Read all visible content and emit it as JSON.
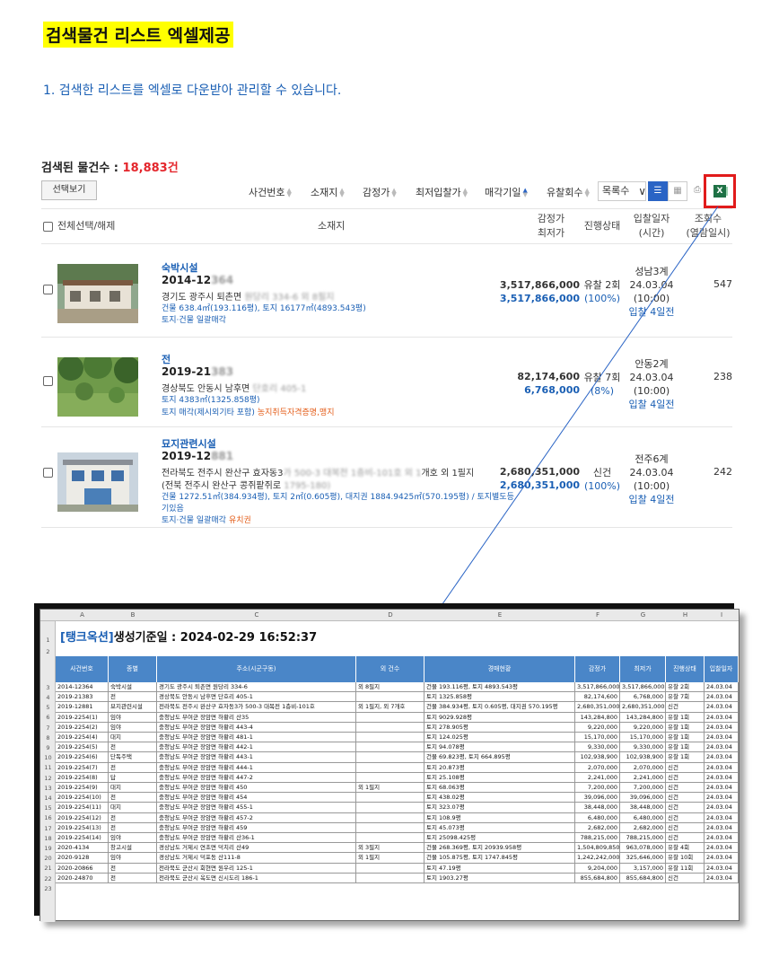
{
  "page": {
    "title": "검색물건 리스트 엑셀제공",
    "step": "1.  검색한 리스트를 엑셀로 다운받아 관리할 수 있습니다."
  },
  "results": {
    "label": "검색된 물건수 : ",
    "count": "18,883건"
  },
  "toolbar": {
    "select_view": "선택보기",
    "sorts": [
      "사건번호",
      "소재지",
      "감정가",
      "최저입찰가",
      "매각기일",
      "유찰회수"
    ],
    "dropdown_value": "목록수",
    "colors": {
      "accent": "#2a64c5",
      "excel": "#1e7145",
      "highlight": "#e11b1b"
    }
  },
  "list_header": {
    "select_all": "전체선택/해제",
    "location": "소재지",
    "appraisal": "감정가",
    "minimum": "최저가",
    "progress": "진행상태",
    "bid_date": "입찰일자",
    "bid_time": "(시간)",
    "views": "조회수",
    "views_sub": "(열람일시)"
  },
  "items": [
    {
      "category": "숙박시설",
      "case_prefix": "2014-12",
      "case_blur": "364",
      "addr_prefix": "경기도 광주시 퇴촌면 ",
      "addr_blur": "원당리 334-6 외 8필지",
      "area": "건물 638.4㎡(193.116평), 토지 16177㎡(4893.543평)",
      "tag": "토지·건물 일괄매각",
      "warn": "",
      "appraisal": "3,517,866,000",
      "minimum": "3,517,866,000",
      "status": "유찰 2회",
      "pct": "(100%)",
      "court": "성남3계",
      "date": "24.03.04",
      "time": "(10:00)",
      "countdown": "입찰 4일전",
      "views": "547"
    },
    {
      "category": "전",
      "case_prefix": "2019-21",
      "case_blur": "383",
      "addr_prefix": "경상북도 안동시 남후면 ",
      "addr_blur": "단호리 405-1",
      "area": "토지 4383㎡(1325.858평)",
      "tag": "토지 매각(제시외기타 포함)",
      "warn": "농지취득자격증명,맹지",
      "appraisal": "82,174,600",
      "minimum": "6,768,000",
      "status": "유찰 7회",
      "pct": "(8%)",
      "court": "안동2계",
      "date": "24.03.04",
      "time": "(10:00)",
      "countdown": "입찰 4일전",
      "views": "238"
    },
    {
      "category": "묘지관련시설",
      "case_prefix": "2019-12",
      "case_blur": "881",
      "addr_prefix": "전라북도 전주시 완산구 효자동3",
      "addr_blur": "가 500-3 대복전 1층비-101호 외 1",
      "addr_suffix": "개호 외 1필지",
      "addr2_prefix": "(전북 전주시 완산구 콩쥐팥쥐로 ",
      "addr2_blur": "1795-180)",
      "area": "건물 1272.51㎡(384.934평), 토지 2㎡(0.605평), 대지권 1884.9425㎡(570.195평) / 토지별도등",
      "area2": "기있음",
      "tag": "토지·건물 일괄매각",
      "warn": "유치권",
      "appraisal": "2,680,351,000",
      "minimum": "2,680,351,000",
      "status": "신건",
      "pct": "(100%)",
      "court": "전주6계",
      "date": "24.03.04",
      "time": "(10:00)",
      "countdown": "입찰 4일전",
      "views": "242"
    }
  ],
  "sheet": {
    "brand": "[탱크옥션]",
    "title_rest": "생성기준일 : 2024-02-29 16:52:37",
    "col_letters": [
      "A",
      "B",
      "C",
      "D",
      "E",
      "F",
      "G",
      "H",
      "I"
    ],
    "headers": [
      "사건번호",
      "종별",
      "주소(시군구동)",
      "외 건수",
      "경매현황",
      "감정가",
      "최저가",
      "진행상태",
      "입찰일자"
    ],
    "rows": [
      [
        "2014-12364",
        "숙박시설",
        "경기도 광주시 퇴촌면 원당리 334-6",
        "외 8필지",
        "건물 193.116평, 토지 4893.543평",
        "3,517,866,000",
        "3,517,866,000",
        "유찰 2회",
        "24.03.04"
      ],
      [
        "2019-21383",
        "전",
        "경상북도 안동시 남후면 단호리 405-1",
        "",
        "토지 1325.858평",
        "82,174,600",
        "6,768,000",
        "유찰 7회",
        "24.03.04"
      ],
      [
        "2019-12881",
        "묘지관련시설",
        "전라북도 전주시 완산구 효자동3가 500-3 대복전 1층비-101호",
        "외 1필지, 외 7개호",
        "건물 384.934평, 토지 0.605평, 대지권 570.195평",
        "2,680,351,000",
        "2,680,351,000",
        "신건",
        "24.03.04"
      ],
      [
        "2019-2254(1)",
        "임야",
        "충청남도 부여군 장암면 하황리 산35",
        "",
        "토지 9029.928평",
        "143,284,800",
        "143,284,800",
        "유찰 1회",
        "24.03.04"
      ],
      [
        "2019-2254(2)",
        "임야",
        "충청남도 부여군 장암면 하황리 443-4",
        "",
        "토지 278.905평",
        "9,220,000",
        "9,220,000",
        "유찰 1회",
        "24.03.04"
      ],
      [
        "2019-2254(4)",
        "대지",
        "충청남도 부여군 장암면 하황리 481-1",
        "",
        "토지 124.025평",
        "15,170,000",
        "15,170,000",
        "유찰 1회",
        "24.03.04"
      ],
      [
        "2019-2254(5)",
        "전",
        "충청남도 부여군 장암면 하황리 442-1",
        "",
        "토지 94.078평",
        "9,330,000",
        "9,330,000",
        "유찰 1회",
        "24.03.04"
      ],
      [
        "2019-2254(6)",
        "단독주택",
        "충청남도 부여군 장암면 하황리 443-1",
        "",
        "건물 69.823평, 토지 664.895평",
        "102,938,900",
        "102,938,900",
        "유찰 1회",
        "24.03.04"
      ],
      [
        "2019-2254(7)",
        "전",
        "충청남도 부여군 장암면 하황리 444-1",
        "",
        "토지 20.873평",
        "2,070,000",
        "2,070,000",
        "신건",
        "24.03.04"
      ],
      [
        "2019-2254(8)",
        "답",
        "충청남도 부여군 장암면 하황리 447-2",
        "",
        "토지 25.108평",
        "2,241,000",
        "2,241,000",
        "신건",
        "24.03.04"
      ],
      [
        "2019-2254(9)",
        "대지",
        "충청남도 부여군 장암면 하황리 450",
        "외 1필지",
        "토지 68.063평",
        "7,200,000",
        "7,200,000",
        "신건",
        "24.03.04"
      ],
      [
        "2019-2254(10)",
        "전",
        "충청남도 부여군 장암면 하황리 454",
        "",
        "토지 438.02평",
        "39,096,000",
        "39,096,000",
        "신건",
        "24.03.04"
      ],
      [
        "2019-2254(11)",
        "대지",
        "충청남도 부여군 장암면 하황리 455-1",
        "",
        "토지 323.07평",
        "38,448,000",
        "38,448,000",
        "신건",
        "24.03.04"
      ],
      [
        "2019-2254(12)",
        "전",
        "충청남도 부여군 장암면 하황리 457-2",
        "",
        "토지 108.9평",
        "6,480,000",
        "6,480,000",
        "신건",
        "24.03.04"
      ],
      [
        "2019-2254(13)",
        "전",
        "충청남도 부여군 장암면 하황리 459",
        "",
        "토지 45.073평",
        "2,682,000",
        "2,682,000",
        "신건",
        "24.03.04"
      ],
      [
        "2019-2254(14)",
        "임야",
        "충청남도 부여군 장암면 하황리 산36-1",
        "",
        "토지 25098.425평",
        "788,215,000",
        "788,215,000",
        "신건",
        "24.03.04"
      ],
      [
        "2020-4134",
        "창고시설",
        "경상남도 거제시 연초면 덕치리 산49",
        "외 3필지",
        "건물 268.369평, 토지 20939.958평",
        "1,504,809,850",
        "963,078,000",
        "유찰 4회",
        "24.03.04"
      ],
      [
        "2020-9128",
        "임야",
        "경상남도 거제시 덕포동 산111-8",
        "외 1필지",
        "건물 105.875평, 토지 1747.845평",
        "1,242,242,000",
        "325,646,000",
        "유찰 10회",
        "24.03.04"
      ],
      [
        "2020-20866",
        "전",
        "전라북도 군산시 회현면 원우리 125-1",
        "",
        "토지 47.19평",
        "9,204,000",
        "3,157,000",
        "유찰 11회",
        "24.03.04"
      ],
      [
        "2020-24870",
        "전",
        "전라북도 군산시 옥도면 신시도리 186-1",
        "",
        "토지 1903.27평",
        "855,684,800",
        "855,684,800",
        "신건",
        "24.03.04"
      ]
    ]
  }
}
